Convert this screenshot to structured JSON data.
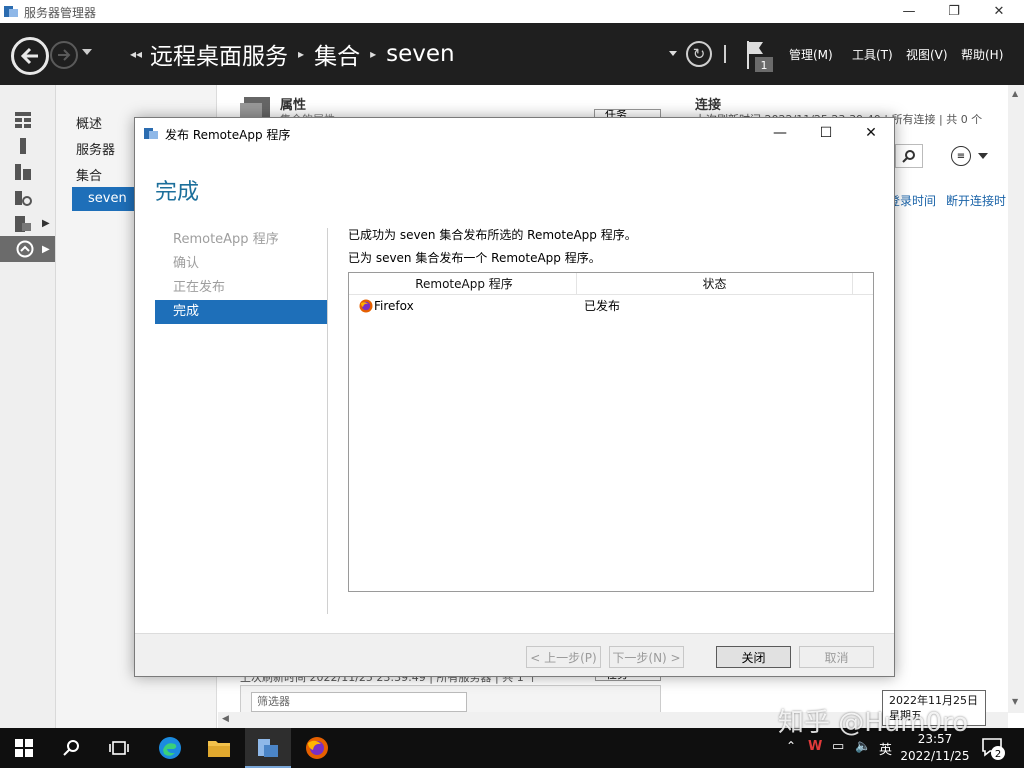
{
  "window": {
    "title": "服务器管理器"
  },
  "header": {
    "breadcrumbs": [
      "远程桌面服务",
      "集合",
      "seven"
    ],
    "flag_count": "1",
    "menus": [
      "管理(M)",
      "工具(T)",
      "视图(V)",
      "帮助(H)"
    ]
  },
  "nav": {
    "items": [
      "概述",
      "服务器",
      "集合"
    ],
    "selected": "seven"
  },
  "background": {
    "properties_title": "属性",
    "properties_sub": "集合的属性",
    "tasks_label": "任务",
    "connections_title": "连接",
    "connections_sub": "上次刷新时间 2022/11/25 23:39:40 | 所有连接 | 共 0 个",
    "col_login_time": "登录时间",
    "col_disconnect_time": "断开连接时",
    "bottom_sub": "上次刷新时间 2022/11/25 23:39:49 | 所有服务器 | 共 1 个",
    "tasks_label2": "任务",
    "filter_placeholder": "筛选器"
  },
  "dialog": {
    "title": "发布 RemoteApp 程序",
    "heading": "完成",
    "steps": [
      "RemoteApp 程序",
      "确认",
      "正在发布",
      "完成"
    ],
    "active_step": 3,
    "message1": "已成功为 seven 集合发布所选的 RemoteApp 程序。",
    "message2": "已为 seven 集合发布一个 RemoteApp 程序。",
    "table": {
      "headers": [
        "RemoteApp 程序",
        "状态"
      ],
      "rows": [
        {
          "program": "Firefox",
          "status": "已发布"
        }
      ]
    },
    "buttons": {
      "prev": "< 上一步(P)",
      "next": "下一步(N) >",
      "close": "关闭",
      "cancel": "取消"
    }
  },
  "taskbar": {
    "ime": "英",
    "time": "23:57",
    "date": "2022/11/25",
    "notif_count": "2"
  },
  "date_popup": {
    "line1": "2022年11月25日",
    "line2": "星期五"
  },
  "watermark": "知乎 @Hum0ro",
  "colors": {
    "accent": "#1e6fb9",
    "header_bg": "#1f1f1f",
    "heading": "#1c6f9b"
  }
}
